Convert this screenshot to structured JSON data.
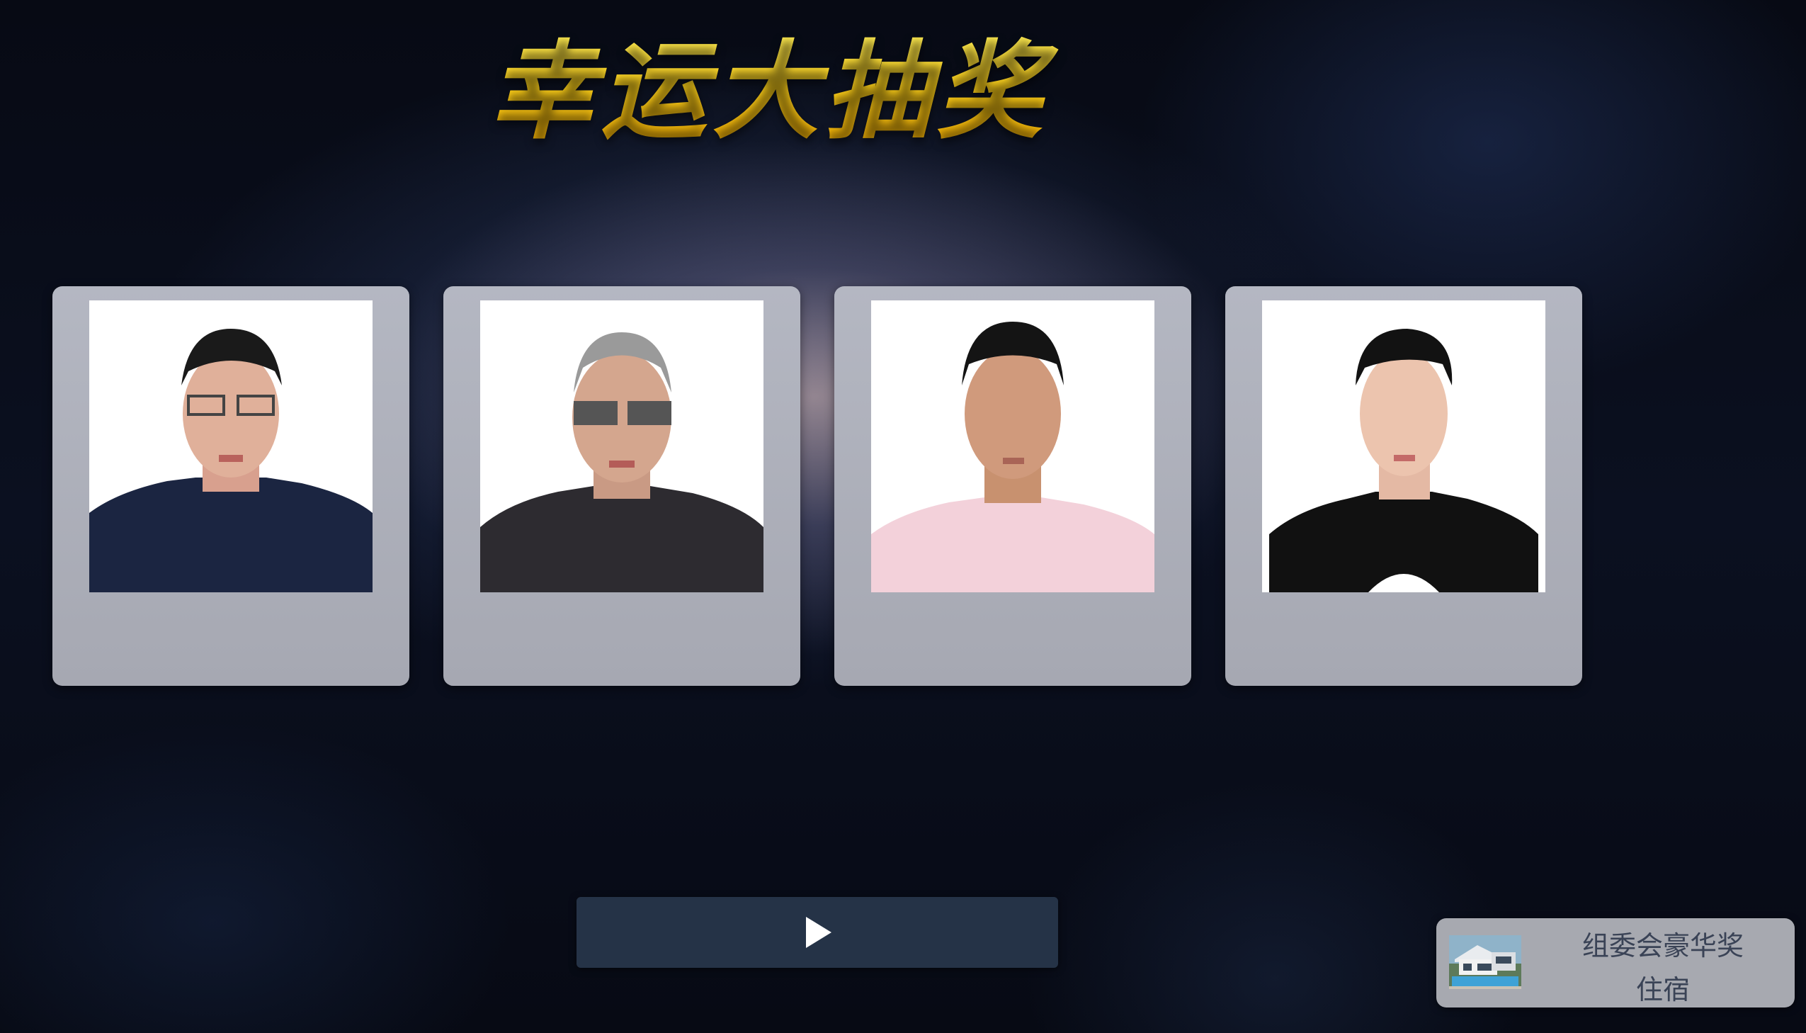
{
  "title": "幸运大抽奖",
  "candidates": [
    {
      "name": "",
      "department": ""
    },
    {
      "name": "",
      "department": ""
    },
    {
      "name": "",
      "department": ""
    },
    {
      "name": "",
      "department": ""
    }
  ],
  "play_button": {
    "icon": "play-icon"
  },
  "prize": {
    "thumbnail_icon": "villa-photo",
    "label_line1": "组委会豪华奖",
    "label_line2": "住宿"
  },
  "colors": {
    "title_gold": "#ffd21a",
    "button_bg": "#253347",
    "card_bg": "#b4b7c2",
    "prize_text": "#3a4356"
  }
}
